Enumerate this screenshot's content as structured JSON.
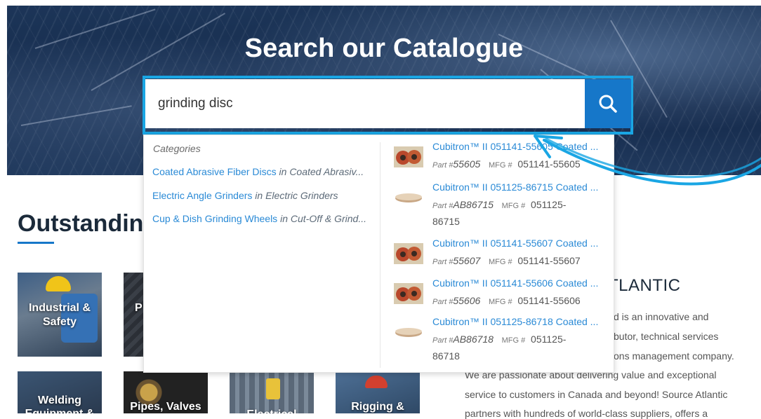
{
  "hero": {
    "title": "Search our Catalogue"
  },
  "search": {
    "value": "grinding disc",
    "button_icon": "search-icon"
  },
  "dropdown": {
    "categories_heading": "Categories",
    "categories": [
      {
        "name": "Coated Abrasive Fiber Discs",
        "in": "in Coated Abrasiv..."
      },
      {
        "name": "Electric Angle Grinders",
        "in": "in Electric Grinders"
      },
      {
        "name": "Cup & Dish Grinding Wheels",
        "in": "in Cut-Off & Grind..."
      }
    ],
    "products": [
      {
        "title": "Cubitron™ II 051141-55605 Coated ...",
        "part_label": "Part #",
        "part": "55605",
        "mfg_label": "MFG #",
        "mfg_1": "051141-55605",
        "mfg_2": "",
        "thumb": "flap-disc-icon"
      },
      {
        "title": "Cubitron™ II 051125-86715 Coated ...",
        "part_label": "Part #",
        "part": "AB86715",
        "mfg_label": "MFG #",
        "mfg_1": "051125-",
        "mfg_2": "86715",
        "thumb": "fiber-disc-icon"
      },
      {
        "title": "Cubitron™ II 051141-55607 Coated ...",
        "part_label": "Part #",
        "part": "55607",
        "mfg_label": "MFG #",
        "mfg_1": "051141-55607",
        "mfg_2": "",
        "thumb": "flap-disc-icon"
      },
      {
        "title": "Cubitron™ II 051141-55606 Coated ...",
        "part_label": "Part #",
        "part": "55606",
        "mfg_label": "MFG #",
        "mfg_1": "051141-55606",
        "mfg_2": "",
        "thumb": "flap-disc-icon"
      },
      {
        "title": "Cubitron™ II 051125-86718 Coated ...",
        "part_label": "Part #",
        "part": "AB86718",
        "mfg_label": "MFG #",
        "mfg_1": "051125-",
        "mfg_2": "86718",
        "thumb": "fiber-disc-icon"
      }
    ]
  },
  "section": {
    "title": "Outstandin"
  },
  "tiles": [
    {
      "label_1": "Industrial &",
      "label_2": "Safety"
    },
    {
      "label_1": "P",
      "label_2": ""
    },
    {
      "label_1": "Welding",
      "label_2": "Equipment &"
    },
    {
      "label_1": "Pipes, Valves",
      "label_2": ""
    },
    {
      "label_1": "Electrical",
      "label_2": ""
    },
    {
      "label_1": "Rigging &",
      "label_2": ""
    }
  ],
  "about": {
    "heading": "TLANTIC",
    "lines": [
      "d is an innovative and",
      "butor, technical services",
      "ons management company.",
      "We are passionate about delivering value and exceptional",
      "service to customers in Canada and beyond! Source Atlantic",
      "partners with hundreds of world-class suppliers, offers a"
    ]
  },
  "colors": {
    "accent": "#1aa6e4",
    "search_button": "#1677c9",
    "link": "#2a8ad6",
    "hero": "#1c3558"
  }
}
